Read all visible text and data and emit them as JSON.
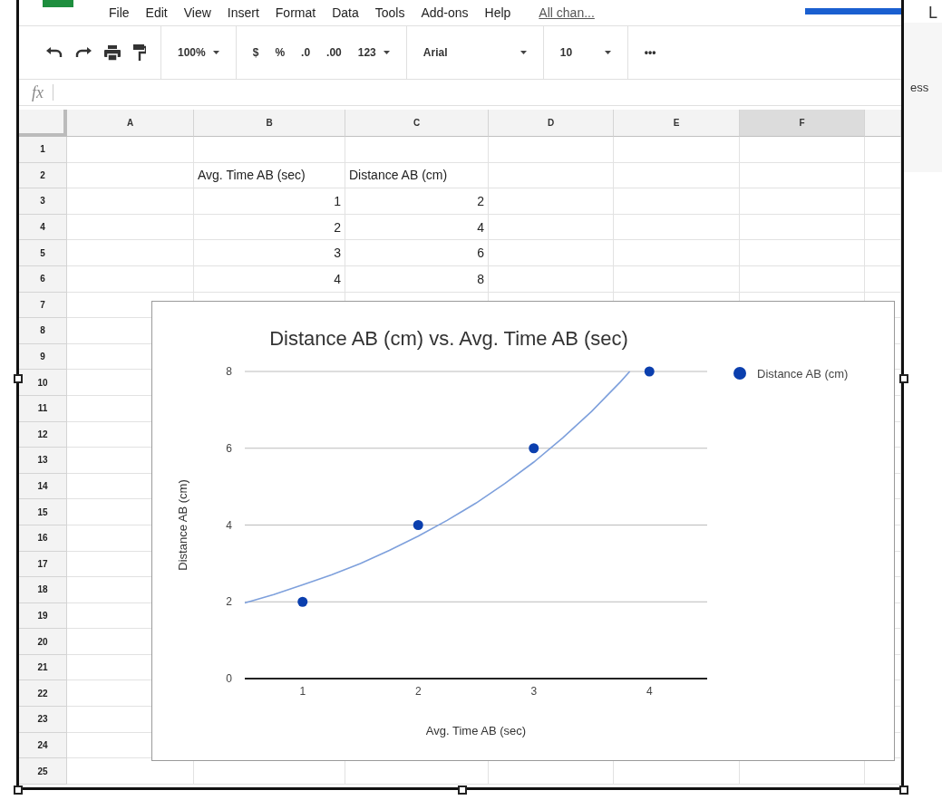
{
  "menu": {
    "items": [
      "File",
      "Edit",
      "View",
      "Insert",
      "Format",
      "Data",
      "Tools",
      "Add-ons",
      "Help"
    ],
    "status_link": "All chan..."
  },
  "toolbar": {
    "zoom": "100%",
    "currency": "$",
    "percent": "%",
    "decrease_decimals": ".0",
    "increase_decimals": ".00",
    "number_format": "123",
    "font": "Arial",
    "font_size": "10",
    "more": "•••"
  },
  "formula_bar": {
    "label": "fx"
  },
  "side_panel": {
    "heading": "L",
    "label": "ess"
  },
  "sheet": {
    "columns": [
      {
        "label": "A",
        "selected": false
      },
      {
        "label": "B",
        "selected": false
      },
      {
        "label": "C",
        "selected": false
      },
      {
        "label": "D",
        "selected": false
      },
      {
        "label": "E",
        "selected": false
      },
      {
        "label": "F",
        "selected": true
      }
    ],
    "rows": [
      {
        "label": "1",
        "cells": []
      },
      {
        "label": "2",
        "cells": [
          null,
          {
            "text": "Avg. Time AB (sec)",
            "kind": "text"
          },
          {
            "text": "Distance AB (cm)",
            "kind": "text"
          }
        ]
      },
      {
        "label": "3",
        "cells": [
          null,
          {
            "text": "1",
            "kind": "number"
          },
          {
            "text": "2",
            "kind": "number"
          }
        ]
      },
      {
        "label": "4",
        "cells": [
          null,
          {
            "text": "2",
            "kind": "number"
          },
          {
            "text": "4",
            "kind": "number"
          }
        ]
      },
      {
        "label": "5",
        "cells": [
          null,
          {
            "text": "3",
            "kind": "number"
          },
          {
            "text": "6",
            "kind": "number"
          }
        ]
      },
      {
        "label": "6",
        "cells": [
          null,
          {
            "text": "4",
            "kind": "number"
          },
          {
            "text": "8",
            "kind": "number"
          }
        ]
      },
      {
        "label": "7",
        "cells": []
      },
      {
        "label": "8",
        "cells": []
      },
      {
        "label": "9",
        "cells": []
      },
      {
        "label": "10",
        "cells": []
      },
      {
        "label": "11",
        "cells": []
      },
      {
        "label": "12",
        "cells": []
      },
      {
        "label": "13",
        "cells": []
      },
      {
        "label": "14",
        "cells": []
      },
      {
        "label": "15",
        "cells": []
      },
      {
        "label": "16",
        "cells": []
      },
      {
        "label": "17",
        "cells": []
      },
      {
        "label": "18",
        "cells": []
      },
      {
        "label": "19",
        "cells": []
      },
      {
        "label": "20",
        "cells": []
      },
      {
        "label": "21",
        "cells": []
      },
      {
        "label": "22",
        "cells": []
      },
      {
        "label": "23",
        "cells": []
      },
      {
        "label": "24",
        "cells": []
      },
      {
        "label": "25",
        "cells": []
      }
    ],
    "chart": {
      "chart_data": {
        "type": "scatter",
        "title": "Distance AB (cm) vs. Avg. Time AB (sec)",
        "xlabel": "Avg. Time AB (sec)",
        "ylabel": "Distance AB (cm)",
        "x": [
          1,
          2,
          3,
          4
        ],
        "series": [
          {
            "name": "Distance AB (cm)",
            "color": "#0b3fae",
            "values": [
              2,
              4,
              6,
              8
            ]
          },
          {
            "type": "line",
            "color": "#7ea0dc",
            "x": [
              0.5,
              0.75,
              1,
              1.25,
              1.5,
              1.75,
              2,
              2.25,
              2.5,
              2.75,
              3,
              3.25,
              3.5,
              3.75,
              3.83
            ],
            "values": [
              1.97,
              2.19,
              2.44,
              2.7,
              3,
              3.34,
              3.71,
              4.12,
              4.57,
              5.08,
              5.64,
              6.27,
              6.96,
              7.73,
              8
            ]
          }
        ],
        "grid": true,
        "xlim": [
          0.5,
          4.5
        ],
        "ylim": [
          0,
          8
        ],
        "xticks": [
          1,
          2,
          3,
          4
        ],
        "yticks": [
          0,
          2,
          4,
          6,
          8
        ]
      }
    }
  }
}
